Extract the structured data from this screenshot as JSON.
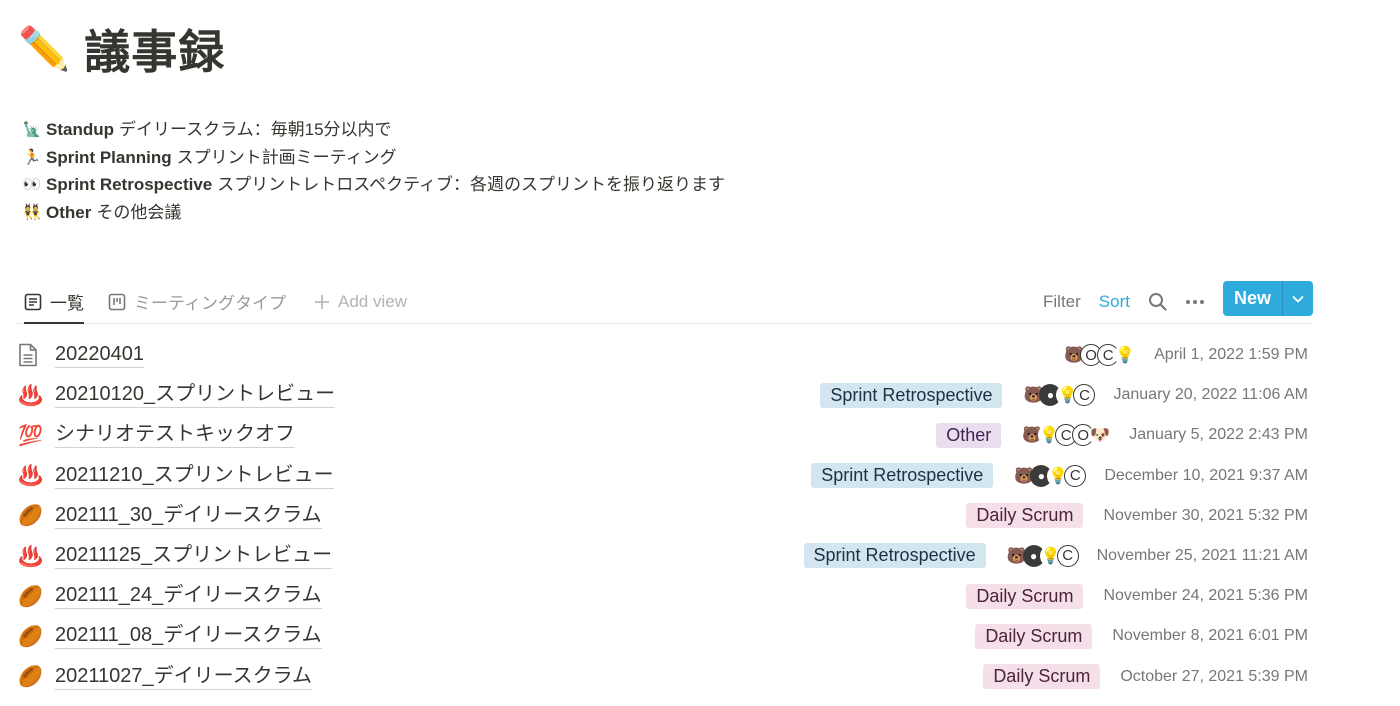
{
  "page": {
    "emoji": "✏️",
    "title": "議事録"
  },
  "description": [
    {
      "emoji": "🗽",
      "bold": "Standup",
      "text": "デイリースクラム：毎朝15分以内で"
    },
    {
      "emoji": "🏃",
      "bold": "Sprint Planning",
      "text": "スプリント計画ミーティング"
    },
    {
      "emoji": "👀",
      "bold": "Sprint Retrospective",
      "text": "スプリントレトロスペクティブ：各週のスプリントを振り返ります"
    },
    {
      "emoji": "👯",
      "bold": "Other",
      "text": "その他会議"
    }
  ],
  "views": {
    "tabs": [
      {
        "label": "一覧",
        "icon": "list-view-icon",
        "active": true
      },
      {
        "label": "ミーティングタイプ",
        "icon": "board-view-icon",
        "active": false
      }
    ],
    "add_view": "Add view",
    "filter": "Filter",
    "sort": "Sort",
    "new": "New"
  },
  "colors": {
    "accent": "#2eaadc",
    "text": "#37352f",
    "muted": "#787774"
  },
  "rows": [
    {
      "icon": "📄",
      "title": "20220401",
      "tag": "",
      "tag_color": "",
      "people": [
        "🐻",
        "O",
        "C",
        "💡"
      ],
      "date": "April 1, 2022 1:59 PM"
    },
    {
      "icon": "♨️",
      "title": "20210120_スプリントレビュー",
      "tag": "Sprint Retrospective",
      "tag_color": "blue",
      "people": [
        "🐻",
        "●",
        "💡",
        "C"
      ],
      "date": "January 20, 2022 11:06 AM"
    },
    {
      "icon": "💯",
      "title": "シナリオテストキックオフ",
      "tag": "Other",
      "tag_color": "purple",
      "people": [
        "🐻",
        "💡",
        "C",
        "O",
        "🐶"
      ],
      "date": "January 5, 2022 2:43 PM"
    },
    {
      "icon": "♨️",
      "title": "20211210_スプリントレビュー",
      "tag": "Sprint Retrospective",
      "tag_color": "blue",
      "people": [
        "🐻",
        "●",
        "💡",
        "C"
      ],
      "date": "December 10, 2021 9:37 AM"
    },
    {
      "icon": "🏉",
      "title": "202111_30_デイリースクラム",
      "tag": "Daily Scrum",
      "tag_color": "pink",
      "people": [],
      "date": "November 30, 2021 5:32 PM"
    },
    {
      "icon": "♨️",
      "title": "20211125_スプリントレビュー",
      "tag": "Sprint Retrospective",
      "tag_color": "blue",
      "people": [
        "🐻",
        "●",
        "💡",
        "C"
      ],
      "date": "November 25, 2021 11:21 AM"
    },
    {
      "icon": "🏉",
      "title": "202111_24_デイリースクラム",
      "tag": "Daily Scrum",
      "tag_color": "pink",
      "people": [],
      "date": "November 24, 2021 5:36 PM"
    },
    {
      "icon": "🏉",
      "title": "202111_08_デイリースクラム",
      "tag": "Daily Scrum",
      "tag_color": "pink",
      "people": [],
      "date": "November 8, 2021 6:01 PM"
    },
    {
      "icon": "🏉",
      "title": "20211027_デイリースクラム",
      "tag": "Daily Scrum",
      "tag_color": "pink",
      "people": [],
      "date": "October 27, 2021 5:39 PM"
    }
  ]
}
